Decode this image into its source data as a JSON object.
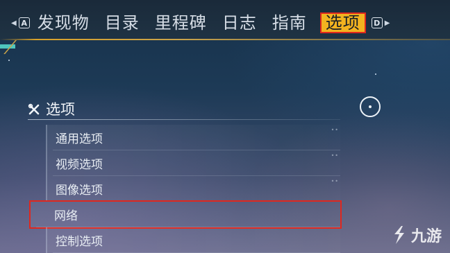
{
  "nav": {
    "prev_key": "A",
    "next_key": "D",
    "tabs": [
      {
        "label": "发现物"
      },
      {
        "label": "目录"
      },
      {
        "label": "里程碑"
      },
      {
        "label": "日志"
      },
      {
        "label": "指南"
      },
      {
        "label": "选项",
        "active": true
      }
    ]
  },
  "options_panel": {
    "title": "选项",
    "items": [
      {
        "label": "通用选项"
      },
      {
        "label": "视频选项"
      },
      {
        "label": "图像选项"
      },
      {
        "label": "网络",
        "highlighted": true
      },
      {
        "label": "控制选项"
      }
    ]
  },
  "watermark": {
    "text": "九游"
  },
  "colors": {
    "active_tab_bg": "#f3b320",
    "highlight_outline": "#e0271e",
    "accent_teal": "#4fc6bd"
  }
}
